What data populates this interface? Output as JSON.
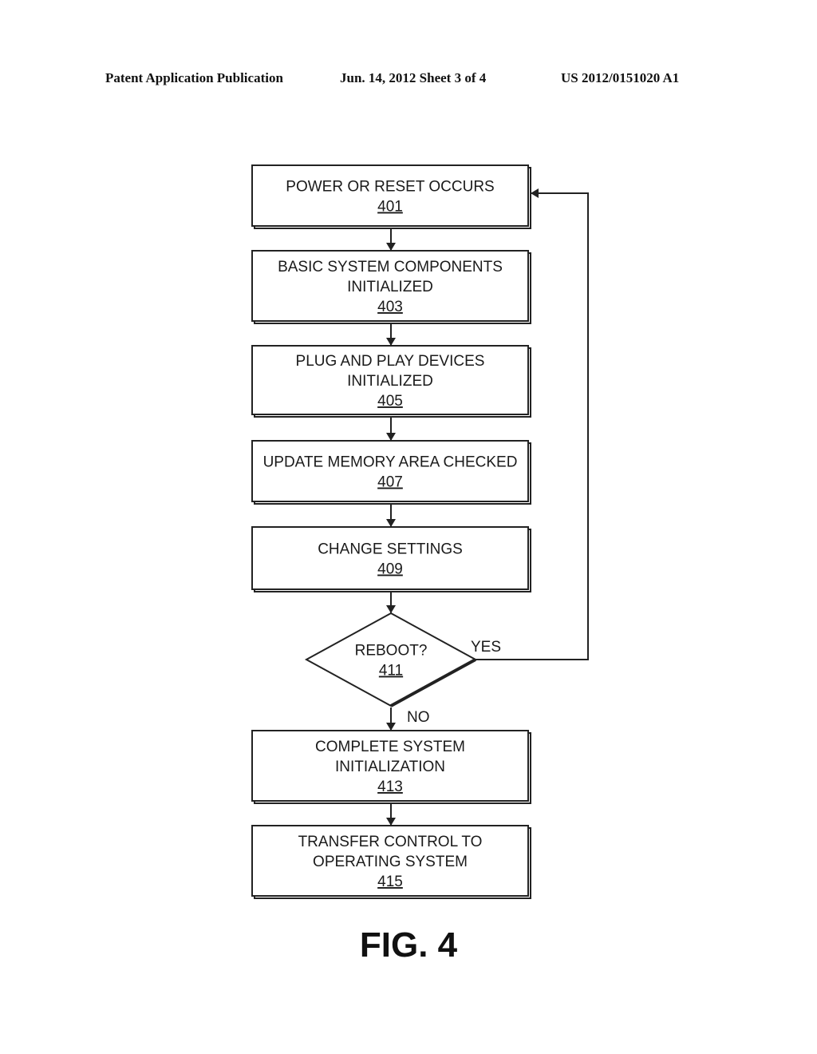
{
  "header": {
    "left": "Patent Application Publication",
    "middle": "Jun. 14, 2012  Sheet 3 of 4",
    "right": "US 2012/0151020 A1"
  },
  "flowchart": {
    "nodes": [
      {
        "id": "401",
        "type": "process",
        "lines": [
          "POWER OR RESET OCCURS"
        ],
        "ref": "401"
      },
      {
        "id": "403",
        "type": "process",
        "lines": [
          "BASIC SYSTEM COMPONENTS",
          "INITIALIZED"
        ],
        "ref": "403"
      },
      {
        "id": "405",
        "type": "process",
        "lines": [
          "PLUG AND PLAY DEVICES",
          "INITIALIZED"
        ],
        "ref": "405"
      },
      {
        "id": "407",
        "type": "process",
        "lines": [
          "UPDATE MEMORY AREA CHECKED"
        ],
        "ref": "407"
      },
      {
        "id": "409",
        "type": "process",
        "lines": [
          "CHANGE SETTINGS"
        ],
        "ref": "409"
      },
      {
        "id": "411",
        "type": "decision",
        "lines": [
          "REBOOT?"
        ],
        "ref": "411"
      },
      {
        "id": "413",
        "type": "process",
        "lines": [
          "COMPLETE SYSTEM",
          "INITIALIZATION"
        ],
        "ref": "413"
      },
      {
        "id": "415",
        "type": "process",
        "lines": [
          "TRANSFER CONTROL TO",
          "OPERATING SYSTEM"
        ],
        "ref": "415"
      }
    ],
    "edges": [
      {
        "from": "401",
        "to": "403",
        "label": ""
      },
      {
        "from": "403",
        "to": "405",
        "label": ""
      },
      {
        "from": "405",
        "to": "407",
        "label": ""
      },
      {
        "from": "407",
        "to": "409",
        "label": ""
      },
      {
        "from": "409",
        "to": "411",
        "label": ""
      },
      {
        "from": "411",
        "to": "401",
        "label": "YES"
      },
      {
        "from": "411",
        "to": "413",
        "label": "NO"
      },
      {
        "from": "413",
        "to": "415",
        "label": ""
      }
    ]
  },
  "figure_label": "FIG. 4"
}
